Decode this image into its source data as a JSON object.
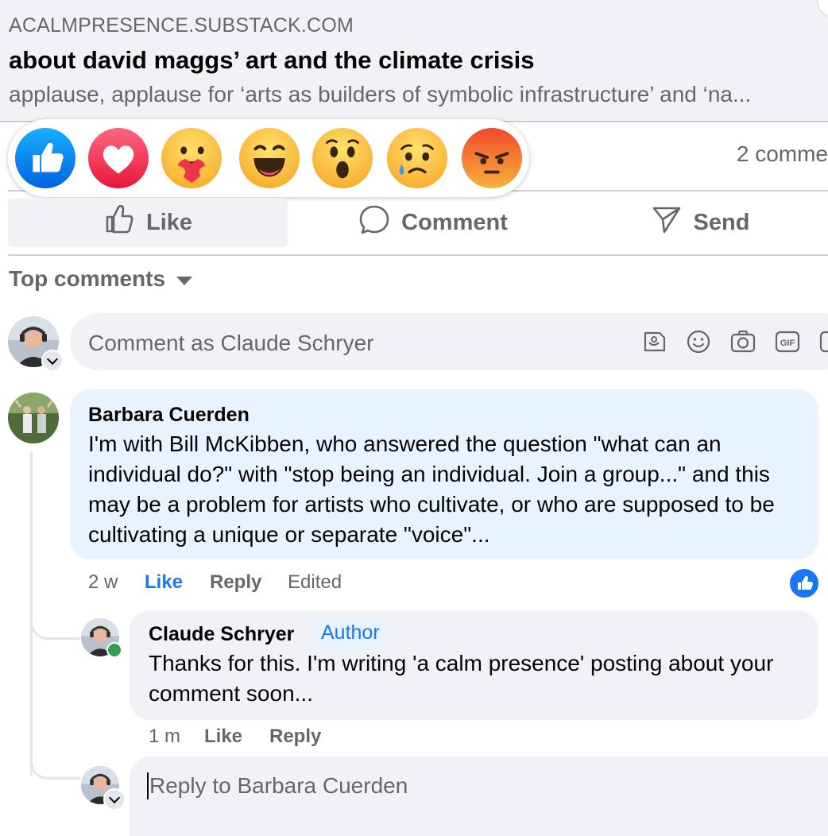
{
  "link_preview": {
    "domain": "ACALMPRESENCE.SUBSTACK.COM",
    "title": "about david maggs’ art and the climate crisis",
    "description": "applause, applause for ‘arts as builders of symbolic infrastructure’ and ‘na..."
  },
  "reactions": {
    "items": [
      "like-icon",
      "love-icon",
      "care-icon",
      "haha-icon",
      "wow-icon",
      "sad-icon",
      "angry-icon"
    ]
  },
  "stats": {
    "comment_count": "2 comme"
  },
  "actions": {
    "like": "Like",
    "comment": "Comment",
    "send": "Send"
  },
  "comments_section": {
    "sort_label": "Top comments",
    "composer_placeholder": "Comment as Claude Schryer"
  },
  "comments": [
    {
      "author": "Barbara Cuerden",
      "text": "I'm with Bill McKibben, who answered the question \"what can an individual do?\" with \"stop being an individual. Join a group...\" and this may be a problem for artists who cultivate, or who are supposed to be cultivating a unique or separate \"voice\"...",
      "time": "2 w",
      "like_label": "Like",
      "reply_label": "Reply",
      "edited_label": "Edited",
      "reaction": "like-icon",
      "replies": [
        {
          "author": "Claude Schryer",
          "badge": "Author",
          "text": "Thanks for this. I'm writing 'a calm presence' posting about your comment soon...",
          "time": "1 m",
          "like_label": "Like",
          "reply_label": "Reply"
        }
      ]
    }
  ],
  "reply_composer": {
    "placeholder": "Reply to Barbara Cuerden"
  },
  "colors": {
    "accent": "#1877f2",
    "muted_text": "#65676b",
    "bubble_gray": "#f0f2f5",
    "bubble_highlight": "#e7f3ff",
    "online": "#31a24c"
  }
}
